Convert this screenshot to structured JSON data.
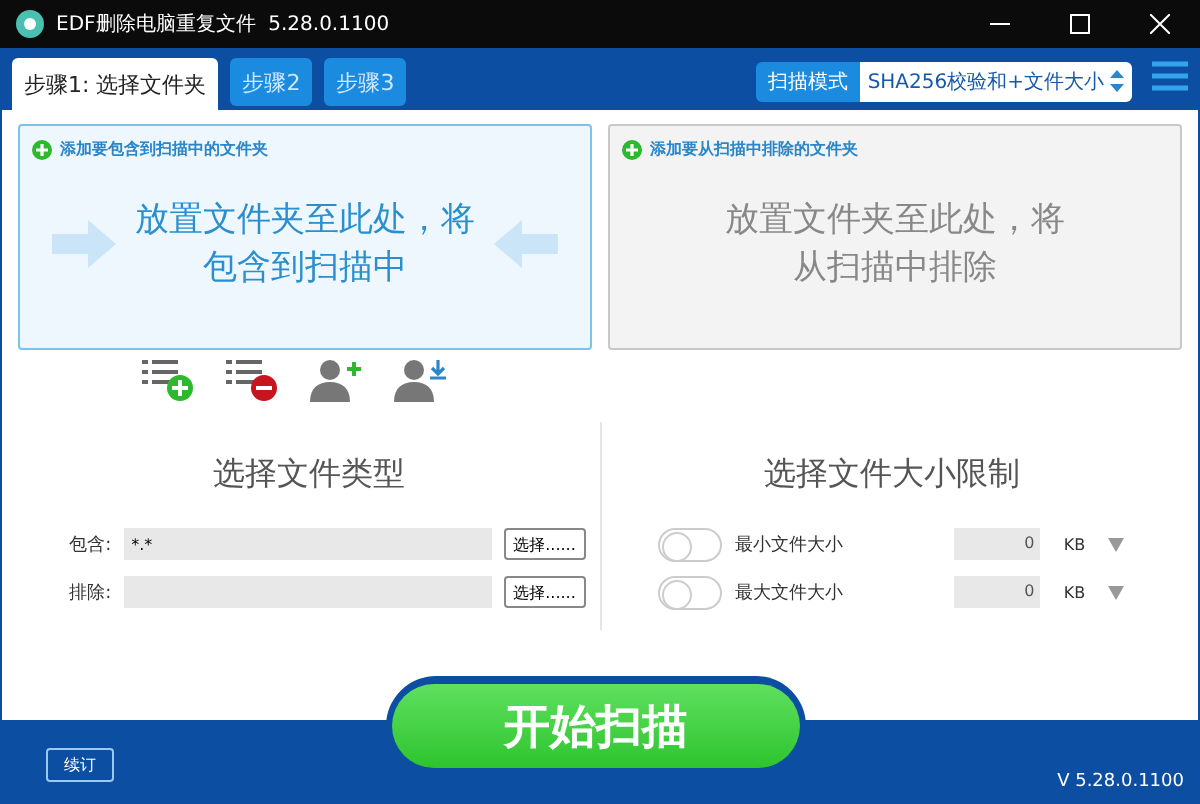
{
  "window": {
    "title": "EDF删除电脑重复文件  5.28.0.1100"
  },
  "tabs": [
    {
      "label": "步骤1: 选择文件夹",
      "selected": true
    },
    {
      "label": "步骤2",
      "selected": false
    },
    {
      "label": "步骤3",
      "selected": false
    }
  ],
  "scan_mode": {
    "label": "扫描模式",
    "value": "SHA256校验和+文件大小"
  },
  "drop_zones": [
    {
      "header": "添加要包含到扫描中的文件夹",
      "text": "放置文件夹至此处，将包含到扫描中",
      "active": true
    },
    {
      "header": "添加要从扫描中排除的文件夹",
      "text": "放置文件夹至此处，将从扫描中排除",
      "active": false
    }
  ],
  "file_types": {
    "title": "选择文件类型",
    "rows": [
      {
        "label": "包含:",
        "value": "*.*",
        "button": "选择......"
      },
      {
        "label": "排除:",
        "button": "选择......"
      }
    ]
  },
  "size_limits": {
    "title": "选择文件大小限制",
    "rows": [
      {
        "label": "最小文件大小",
        "on": false,
        "value": "0",
        "unit": "KB"
      },
      {
        "label": "最大文件大小",
        "on": false,
        "value": "0",
        "unit": "KB"
      }
    ]
  },
  "start_button": "开始扫描",
  "footer": {
    "button": "续订",
    "version": "V 5.28.0.1100"
  }
}
